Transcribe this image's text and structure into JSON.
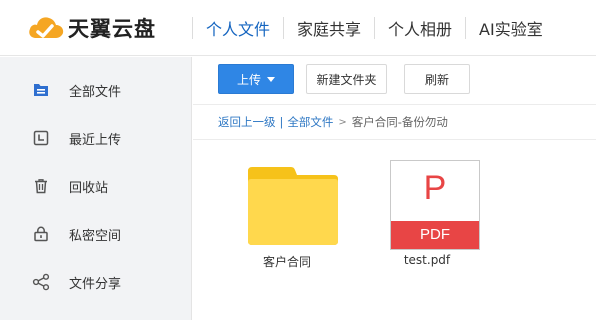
{
  "brand": {
    "name": "天翼云盘"
  },
  "nav": {
    "items": [
      {
        "label": "个人文件",
        "active": true
      },
      {
        "label": "家庭共享",
        "active": false
      },
      {
        "label": "个人相册",
        "active": false
      },
      {
        "label": "AI实验室",
        "active": false
      }
    ]
  },
  "sidebar": {
    "items": [
      {
        "label": "全部文件",
        "icon": "folder-file-icon"
      },
      {
        "label": "最近上传",
        "icon": "clock-icon"
      },
      {
        "label": "回收站",
        "icon": "trash-icon"
      },
      {
        "label": "私密空间",
        "icon": "lock-icon"
      },
      {
        "label": "文件分享",
        "icon": "share-icon"
      }
    ]
  },
  "toolbar": {
    "upload_label": "上传",
    "new_folder_label": "新建文件夹",
    "refresh_label": "刷新"
  },
  "breadcrumb": {
    "back": "返回上一级",
    "separator": "|",
    "all_files": "全部文件",
    "arrow": ">",
    "current": "客户合同-备份勿动"
  },
  "files": [
    {
      "name": "客户合同",
      "type": "folder"
    },
    {
      "name": "test.pdf",
      "type": "pdf",
      "icon_letter": "P",
      "icon_band": "PDF"
    }
  ],
  "colors": {
    "accent": "#1565c0",
    "primary_button": "#2f86e5",
    "folder": "#ffd84d",
    "pdf_red": "#e84545",
    "sidebar_bg": "#f2f3f5"
  }
}
